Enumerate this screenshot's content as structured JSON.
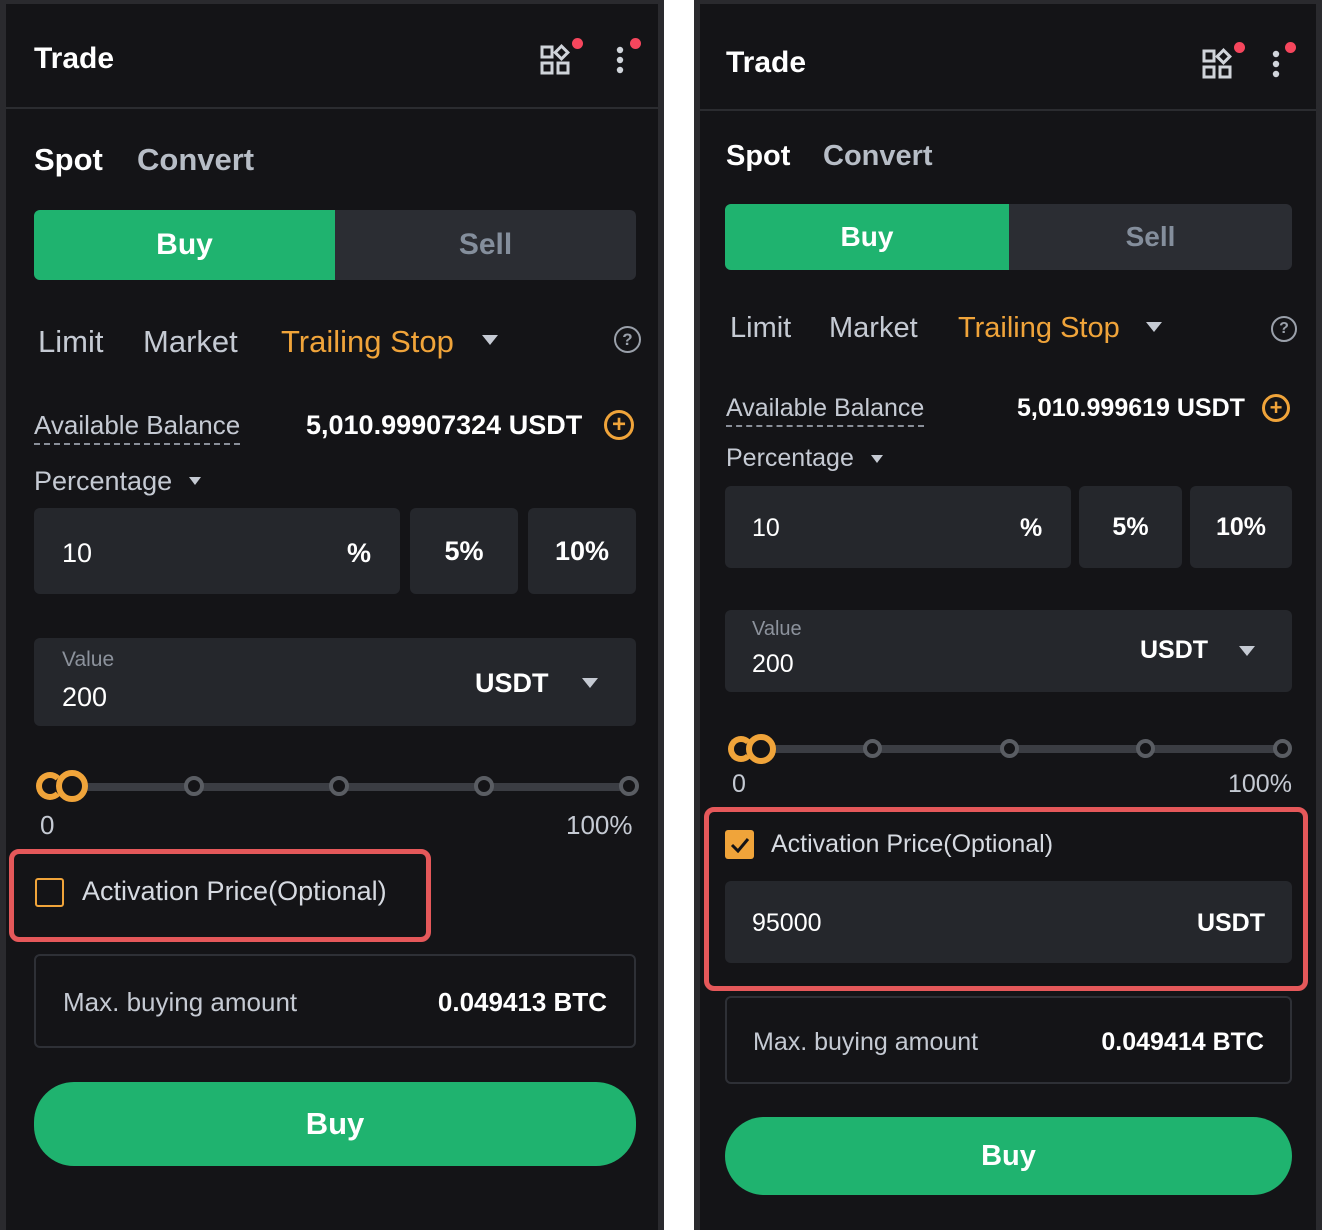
{
  "left": {
    "header": {
      "title": "Trade"
    },
    "tabs": [
      {
        "label": "Spot"
      },
      {
        "label": "Convert"
      }
    ],
    "side": {
      "buy": "Buy",
      "sell": "Sell"
    },
    "order_types": [
      {
        "label": "Limit"
      },
      {
        "label": "Market"
      },
      {
        "label": "Trailing Stop"
      }
    ],
    "help": "?",
    "available": {
      "label": "Available Balance",
      "value": "5,010.99907324 USDT"
    },
    "percentage_label": "Percentage",
    "percentage": {
      "value": "10",
      "unit": "%",
      "preset1": "5%",
      "preset2": "10%"
    },
    "value_field": {
      "label": "Value",
      "value": "200",
      "currency": "USDT"
    },
    "slider": {
      "min_label": "0",
      "max_label": "100%",
      "position": 0
    },
    "activation": {
      "label": "Activation Price(Optional)",
      "checked": false
    },
    "max_buying": {
      "label": "Max. buying amount",
      "value": "0.049413 BTC"
    },
    "buy_button": "Buy"
  },
  "right": {
    "header": {
      "title": "Trade"
    },
    "tabs": [
      {
        "label": "Spot"
      },
      {
        "label": "Convert"
      }
    ],
    "side": {
      "buy": "Buy",
      "sell": "Sell"
    },
    "order_types": [
      {
        "label": "Limit"
      },
      {
        "label": "Market"
      },
      {
        "label": "Trailing Stop"
      }
    ],
    "help": "?",
    "available": {
      "label": "Available Balance",
      "value": "5,010.999619 USDT"
    },
    "percentage_label": "Percentage",
    "percentage": {
      "value": "10",
      "unit": "%",
      "preset1": "5%",
      "preset2": "10%"
    },
    "value_field": {
      "label": "Value",
      "value": "200",
      "currency": "USDT"
    },
    "slider": {
      "min_label": "0",
      "max_label": "100%",
      "position": 0
    },
    "activation": {
      "label": "Activation Price(Optional)",
      "checked": true,
      "price": "95000",
      "currency": "USDT"
    },
    "max_buying": {
      "label": "Max. buying amount",
      "value": "0.049414 BTC"
    },
    "buy_button": "Buy"
  },
  "colors": {
    "buy_green": "#1fb36f",
    "accent_orange": "#f0a43a",
    "panel_bg": "#141417",
    "highlight_red": "#e5585a",
    "notification_red": "#f6465d"
  },
  "icons": [
    "grid-apps-icon",
    "more-vertical-icon",
    "help-icon",
    "add-funds-icon",
    "dropdown-caret-icon",
    "checkbox-icon"
  ]
}
